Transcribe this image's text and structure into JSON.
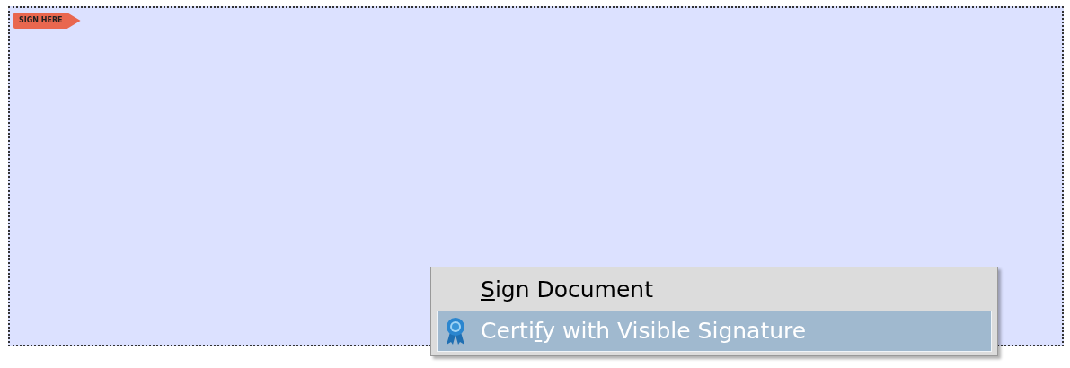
{
  "signature_field": {
    "tag": "SIGN HERE"
  },
  "context_menu": {
    "items": [
      {
        "access_key": "S",
        "label_after": "ign Document",
        "icon": false,
        "selected": false
      },
      {
        "label_before": "Certi",
        "access_key": "f",
        "label_after": "y with Visible Signature",
        "icon": true,
        "selected": true
      }
    ]
  }
}
